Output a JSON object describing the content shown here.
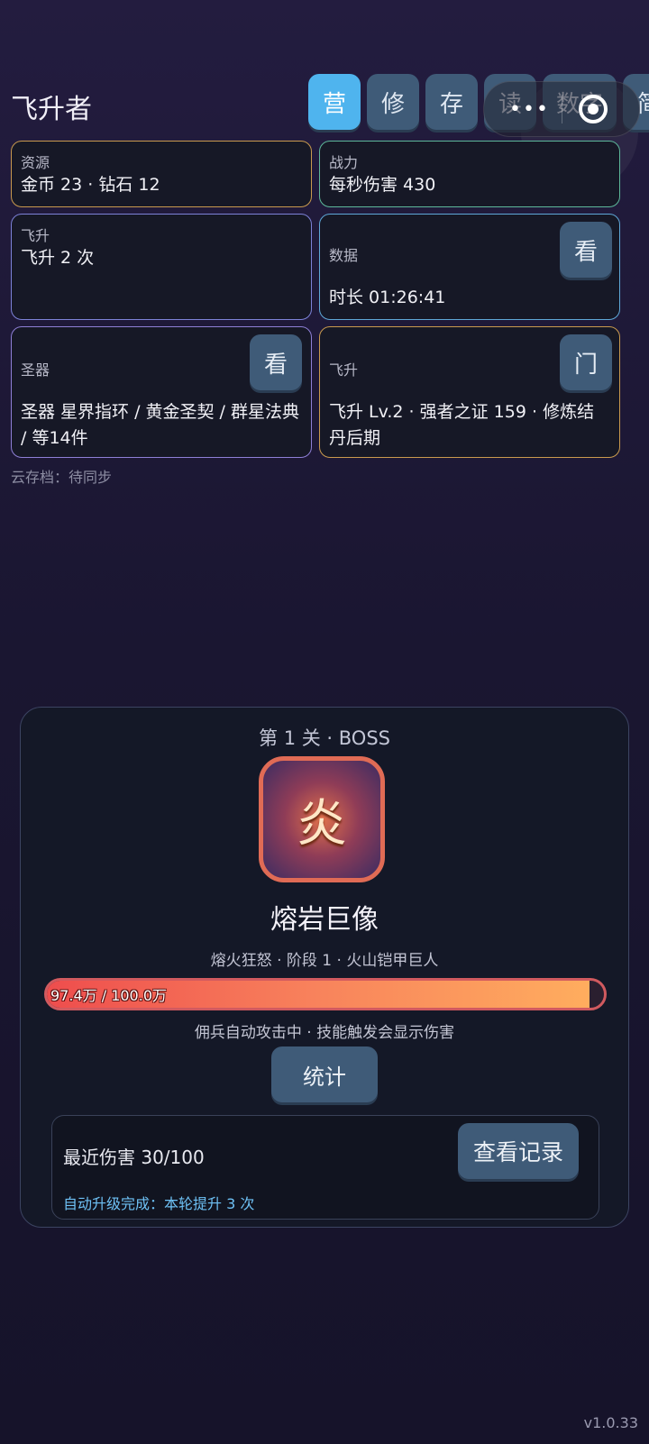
{
  "header": {
    "title": "飞升者",
    "tabs": [
      {
        "label": "营",
        "active": true
      },
      {
        "label": "修",
        "active": false
      },
      {
        "label": "存",
        "active": false
      },
      {
        "label": "读",
        "active": false
      },
      {
        "label": "数字",
        "active": false
      },
      {
        "label": "简",
        "active": false
      }
    ],
    "capsule_more": "•••"
  },
  "cards": {
    "resources": {
      "label": "资源",
      "value": "金币 23 · 钻石 12",
      "border": "#c99a4e"
    },
    "power": {
      "label": "战力",
      "value": "每秒伤害 430",
      "border": "#5db89a"
    },
    "ascend_count": {
      "label": "飞升",
      "value": "飞升 2 次",
      "border": "#7d82d8"
    },
    "data": {
      "label": "数据",
      "value": "时长 01:26:41",
      "button": "看",
      "border": "#5fa8d8"
    },
    "artifacts": {
      "label": "圣器",
      "value": "圣器 星界指环 / 黄金圣契 / 群星法典 / 等14件",
      "button": "看",
      "border": "#8e7fd6"
    },
    "ascend": {
      "label": "飞升",
      "value": "飞升 Lv.2 · 强者之证 159 · 修炼结丹后期",
      "button": "门",
      "border": "#c99a4e"
    }
  },
  "cloud_save": "云存档：待同步",
  "boss": {
    "stage": "第 1 关 · BOSS",
    "glyph": "炎",
    "name": "熔岩巨像",
    "subtitle": "熔火狂怒 · 阶段 1 · 火山铠甲巨人",
    "hp_text": "97.4万 / 100.0万",
    "hp_fraction": 0.974,
    "auto_text": "佣兵自动攻击中 · 技能触发会显示伤害",
    "stat_button": "统计",
    "recent_damage": "最近伤害 30/100",
    "view_log_button": "查看记录",
    "upgrade_text": "自动升级完成：本轮提升 3 次"
  },
  "version": "v1.0.33"
}
